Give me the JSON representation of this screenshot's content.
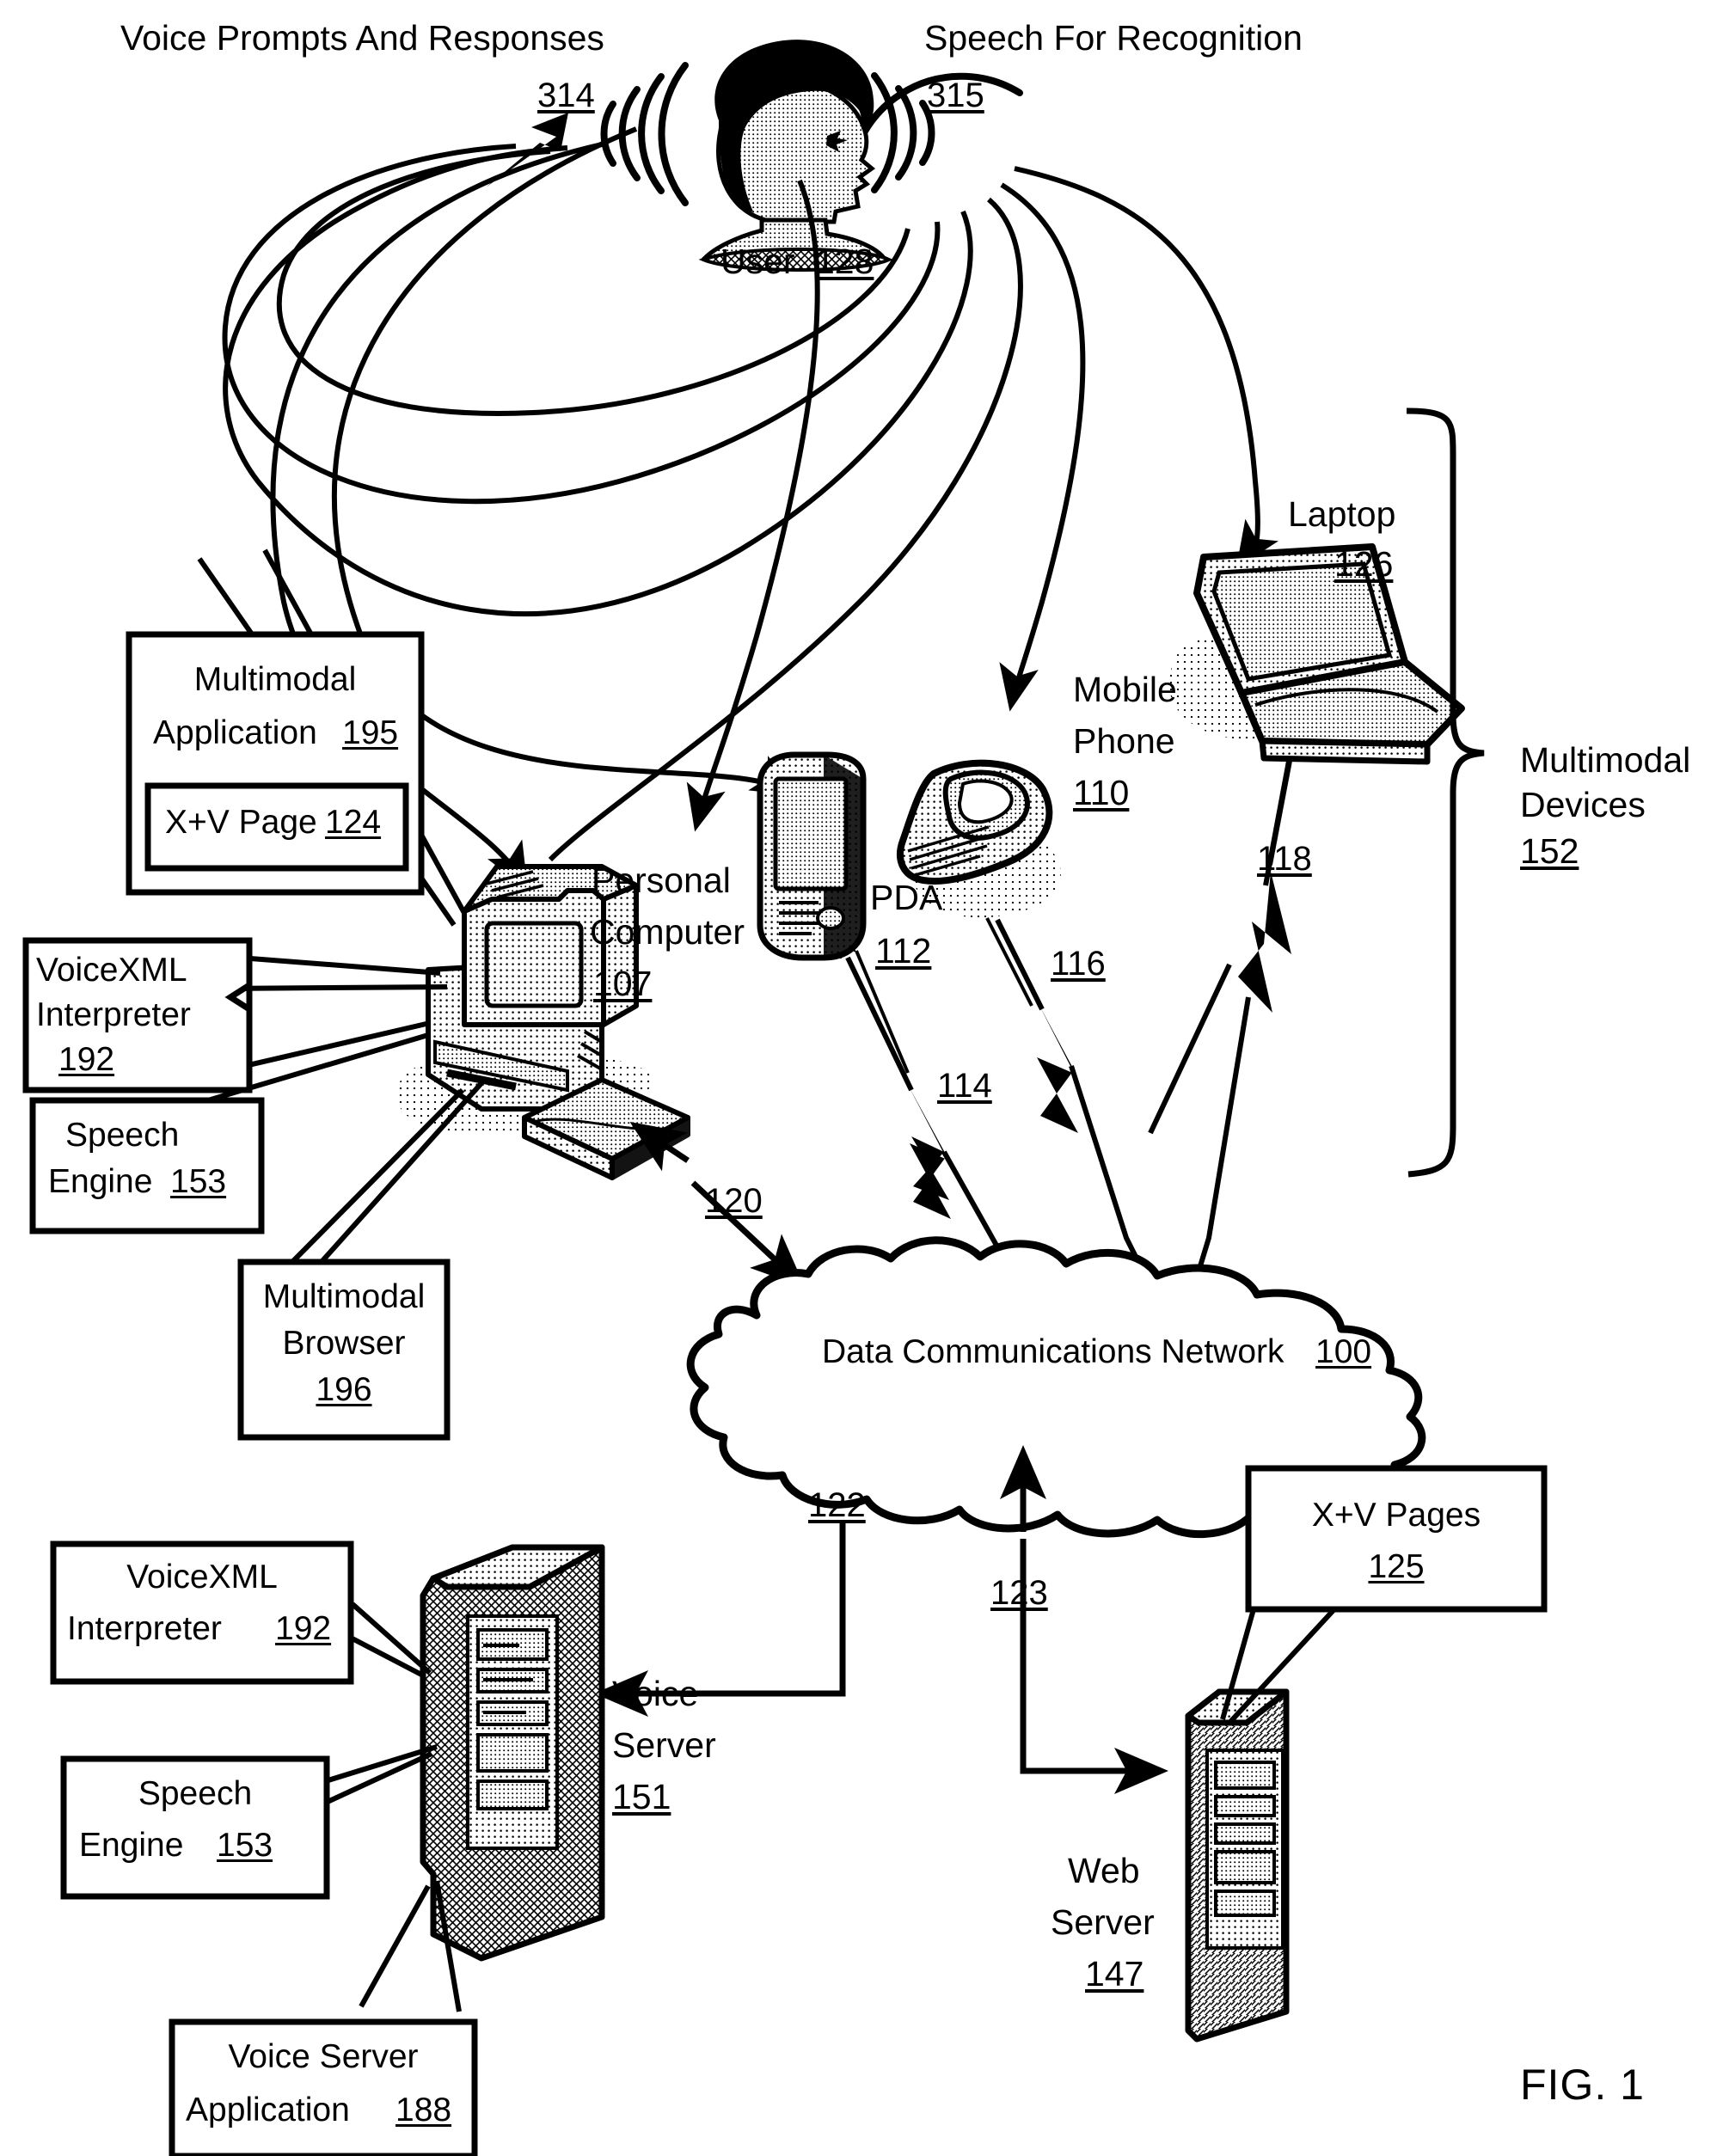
{
  "figure": {
    "label": "FIG. 1"
  },
  "top_labels": {
    "voice_prompts": {
      "text": "Voice Prompts And Responses",
      "ref": "314"
    },
    "speech_recognition": {
      "text": "Speech For Recognition",
      "ref": "315"
    },
    "user": {
      "text": "User",
      "ref": "128"
    }
  },
  "devices": [
    {
      "name": "personal-computer",
      "line1": "Personal",
      "line2": "Computer",
      "ref": "107"
    },
    {
      "name": "pda",
      "line1": "PDA",
      "line2": "",
      "ref": "112"
    },
    {
      "name": "mobile-phone",
      "line1": "Mobile",
      "line2": "Phone",
      "ref": "110"
    },
    {
      "name": "laptop",
      "line1": "Laptop",
      "line2": "",
      "ref": "126"
    }
  ],
  "group_brace": {
    "line1": "Multimodal",
    "line2": "Devices",
    "ref": "152"
  },
  "callouts": {
    "multimodal_application": {
      "line1": "Multimodal",
      "line2": "Application",
      "ref": "195"
    },
    "xv_page": {
      "label": "X+V Page",
      "ref": "124"
    },
    "voicexml_interpreter_pc": {
      "line1": "VoiceXML",
      "line2": "Interpreter",
      "ref": "192"
    },
    "speech_engine_pc": {
      "line1": "Speech",
      "line2": "Engine",
      "ref": "153"
    },
    "multimodal_browser": {
      "line1": "Multimodal",
      "line2": "Browser",
      "ref": "196"
    },
    "voicexml_interpreter_vs": {
      "line1": "VoiceXML",
      "line2": "Interpreter",
      "ref": "192"
    },
    "speech_engine_vs": {
      "line1": "Speech",
      "line2": "Engine",
      "ref": "153"
    },
    "voice_server_application": {
      "line1": "Voice Server",
      "line2": "Application",
      "ref": "188"
    },
    "xv_pages": {
      "line1": "X+V Pages",
      "ref": "125"
    }
  },
  "network": {
    "label": "Data Communications Network",
    "ref": "100"
  },
  "servers": {
    "voice_server": {
      "line1": "Voice",
      "line2": "Server",
      "ref": "151"
    },
    "web_server": {
      "line1": "Web",
      "line2": "Server",
      "ref": "147"
    }
  },
  "connection_refs": {
    "pc_to_network": "120",
    "pda_to_network": "114",
    "phone_to_network": "116",
    "laptop_to_network": "118",
    "network_to_voice_server": "122",
    "network_to_web_server": "123"
  },
  "colors": {
    "ink": "#000000",
    "paper": "#ffffff"
  }
}
